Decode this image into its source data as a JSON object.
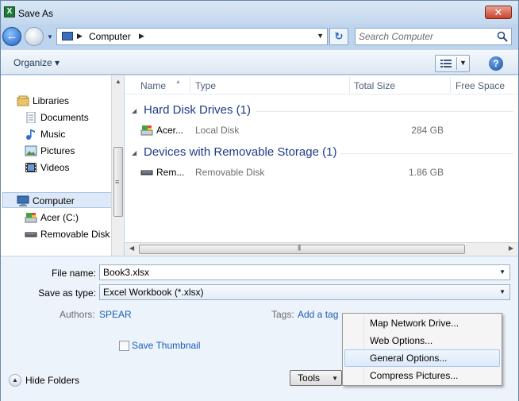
{
  "window": {
    "title": "Save As",
    "close_label": "✕"
  },
  "nav": {
    "address_segments": [
      "Computer"
    ],
    "search_placeholder": "Search Computer"
  },
  "commandbar": {
    "organize_label": "Organize ▾",
    "help_label": "?"
  },
  "sidebar": {
    "items": [
      {
        "label": "Libraries",
        "icon": "libraries-icon"
      },
      {
        "label": "Documents",
        "icon": "documents-icon"
      },
      {
        "label": "Music",
        "icon": "music-icon"
      },
      {
        "label": "Pictures",
        "icon": "pictures-icon"
      },
      {
        "label": "Videos",
        "icon": "videos-icon"
      },
      {
        "label": "Computer",
        "icon": "computer-icon"
      },
      {
        "label": "Acer (C:)",
        "icon": "drive-icon"
      },
      {
        "label": "Removable Disk (",
        "icon": "removable-disk-icon"
      }
    ],
    "selected": "Computer"
  },
  "columns": [
    "Name",
    "Type",
    "Total Size",
    "Free Space"
  ],
  "groups": [
    {
      "title": "Hard Disk Drives (1)",
      "rows": [
        {
          "name": "Acer...",
          "type": "Local Disk",
          "size": "284 GB"
        }
      ]
    },
    {
      "title": "Devices with Removable Storage (1)",
      "rows": [
        {
          "name": "Rem...",
          "type": "Removable Disk",
          "size": "1.86 GB"
        }
      ]
    }
  ],
  "form": {
    "file_name_label": "File name:",
    "file_name_value": "Book3.xlsx",
    "save_type_label": "Save as type:",
    "save_type_value": "Excel Workbook (*.xlsx)",
    "authors_label": "Authors:",
    "authors_value": "SPEAR",
    "tags_label": "Tags:",
    "tags_value": "Add a tag",
    "thumbnail_label": "Save Thumbnail",
    "thumbnail_checked": false,
    "hide_folders_label": "Hide Folders",
    "tools_label": "Tools"
  },
  "tools_menu": {
    "items": [
      "Map Network Drive...",
      "Web Options...",
      "General Options...",
      "Compress Pictures..."
    ],
    "highlighted": "General Options..."
  },
  "colors": {
    "accent": "#1b5db8",
    "group_title": "#1e3a8a",
    "highlight": "#dceafb"
  }
}
